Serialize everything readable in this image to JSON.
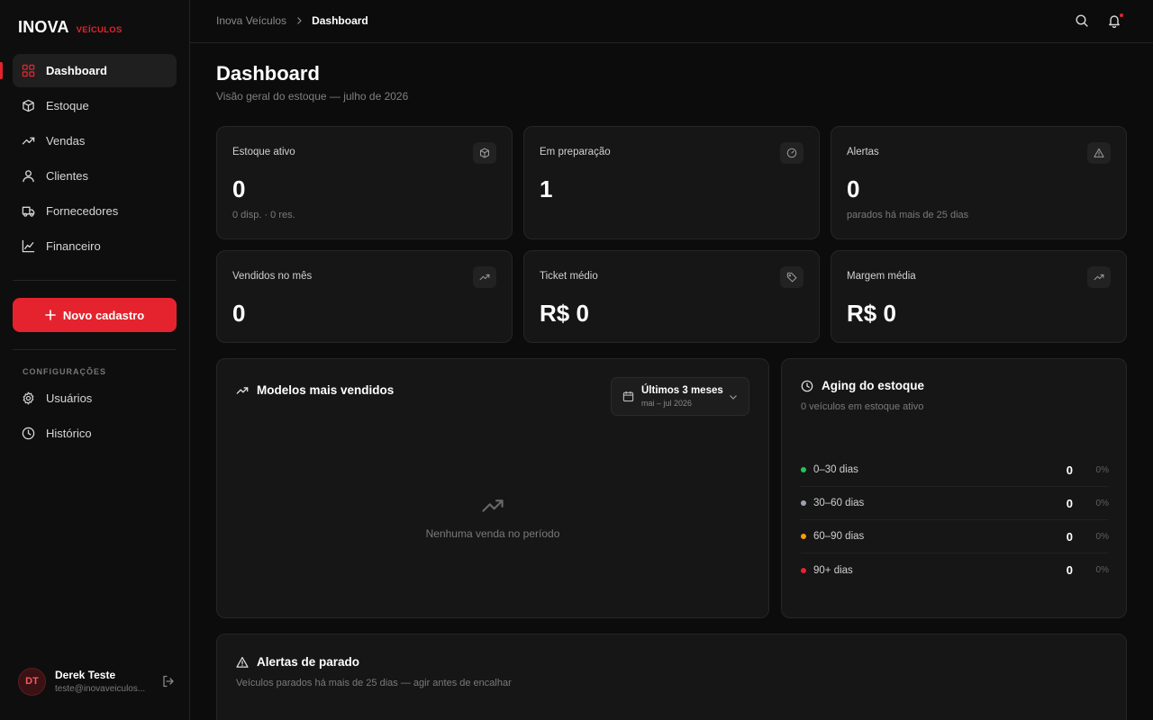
{
  "brand": {
    "name": "INOVA",
    "tag": "VEÍCULOS",
    "accent": "#e5232e"
  },
  "sidebar": {
    "items": [
      {
        "label": "Dashboard",
        "icon": "grid-icon",
        "active": true
      },
      {
        "label": "Estoque",
        "icon": "box-icon"
      },
      {
        "label": "Vendas",
        "icon": "trend-icon"
      },
      {
        "label": "Clientes",
        "icon": "user-icon"
      },
      {
        "label": "Fornecedores",
        "icon": "truck-icon"
      },
      {
        "label": "Financeiro",
        "icon": "chart-icon"
      }
    ],
    "new_button": "Novo cadastro",
    "settings_label": "CONFIGURAÇÕES",
    "settings_items": [
      {
        "label": "Usuários",
        "icon": "gear-icon"
      },
      {
        "label": "Histórico",
        "icon": "clock-icon"
      }
    ],
    "user": {
      "initials": "DT",
      "name": "Derek Teste",
      "email": "teste@inovaveiculos..."
    }
  },
  "header": {
    "breadcrumb": [
      "Inova Veículos",
      "Dashboard"
    ]
  },
  "page": {
    "title": "Dashboard",
    "subtitle": "Visão geral do estoque — julho de 2026"
  },
  "kpis": [
    {
      "label": "Estoque ativo",
      "value": "0",
      "sub": "0 disp. · 0 res.",
      "icon": "box-icon"
    },
    {
      "label": "Em preparação",
      "value": "1",
      "sub": "",
      "icon": "gauge-icon"
    },
    {
      "label": "Alertas",
      "value": "0",
      "sub": "parados há mais de 25 dias",
      "icon": "alert-icon"
    },
    {
      "label": "Vendidos no mês",
      "value": "0",
      "icon": "trend-icon"
    },
    {
      "label": "Ticket médio",
      "value": "R$ 0",
      "icon": "tag-icon"
    },
    {
      "label": "Margem média",
      "value": "R$ 0",
      "icon": "trend-icon"
    }
  ],
  "top_models": {
    "title": "Modelos mais vendidos",
    "period_label": "Últimos 3 meses",
    "period_range": "mai – jul 2026",
    "empty": "Nenhuma venda no período"
  },
  "aging": {
    "title": "Aging do estoque",
    "subtitle": "0 veículos em estoque ativo",
    "rows": [
      {
        "label": "0–30 dias",
        "count": "0",
        "pct": "0%",
        "color": "#22c55e"
      },
      {
        "label": "30–60 dias",
        "count": "0",
        "pct": "0%",
        "color": "#9ca3af"
      },
      {
        "label": "60–90 dias",
        "count": "0",
        "pct": "0%",
        "color": "#f59e0b"
      },
      {
        "label": "90+ dias",
        "count": "0",
        "pct": "0%",
        "color": "#e5232e"
      }
    ]
  },
  "stale_alerts": {
    "title": "Alertas de parado",
    "subtitle": "Veículos parados há mais de 25 dias — agir antes de encalhar"
  }
}
